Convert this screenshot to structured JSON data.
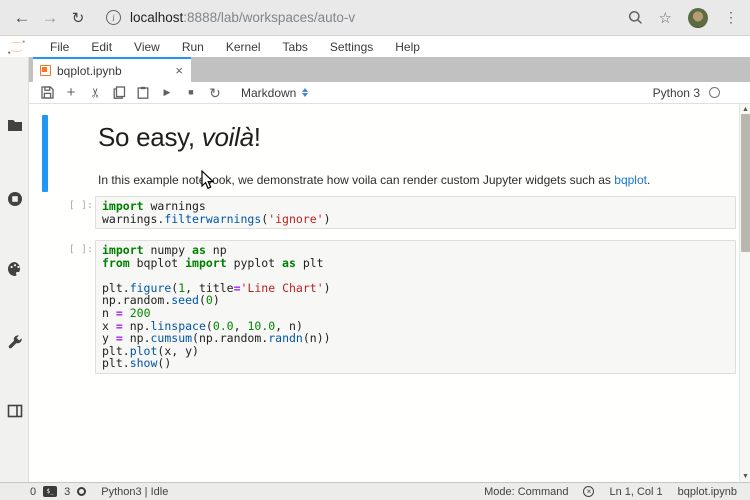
{
  "browser": {
    "back_icon": "left-arrow",
    "forward_icon": "right-arrow",
    "reload_icon": "reload-arrow",
    "url_host": "localhost",
    "url_path": ":8888/lab/workspaces/auto-v",
    "info_glyph": "i",
    "star_glyph": "☆",
    "menu_glyph": "⋮"
  },
  "menu_bar": {
    "items": [
      "File",
      "Edit",
      "View",
      "Run",
      "Kernel",
      "Tabs",
      "Settings",
      "Help"
    ]
  },
  "sidebar": {
    "icons": [
      "folder",
      "running-sessions",
      "palette",
      "wrench",
      "open-tabs"
    ]
  },
  "tab": {
    "title": "bqplot.ipynb",
    "close_glyph": "×"
  },
  "toolbar": {
    "add_glyph": "+",
    "cut_glyph": "✂",
    "run_glyph": "▶",
    "stop_glyph": "■",
    "restart_glyph": "↻",
    "cell_type": "Markdown",
    "kernel_name": "Python 3"
  },
  "notebook": {
    "heading_prefix": "So easy, ",
    "heading_italic": "voilà",
    "heading_suffix": "!",
    "paragraph_before_link": "In this example notebook, we demonstrate how voila can render custom Jupyter widgets such as ",
    "paragraph_link": "bqplot",
    "paragraph_after_link": ".",
    "code_cells": [
      {
        "prompt": "[ ]:",
        "lines": [
          [
            {
              "t": "kw",
              "v": "import"
            },
            {
              "t": "pl",
              "v": " warnings"
            }
          ],
          [
            {
              "t": "pl",
              "v": "warnings."
            },
            {
              "t": "prop",
              "v": "filterwarnings"
            },
            {
              "t": "pl",
              "v": "("
            },
            {
              "t": "str",
              "v": "'ignore'"
            },
            {
              "t": "pl",
              "v": ")"
            }
          ]
        ]
      },
      {
        "prompt": "[ ]:",
        "lines": [
          [
            {
              "t": "kw",
              "v": "import"
            },
            {
              "t": "pl",
              "v": " numpy "
            },
            {
              "t": "kw",
              "v": "as"
            },
            {
              "t": "pl",
              "v": " np"
            }
          ],
          [
            {
              "t": "kw",
              "v": "from"
            },
            {
              "t": "pl",
              "v": " bqplot "
            },
            {
              "t": "kw",
              "v": "import"
            },
            {
              "t": "pl",
              "v": " pyplot "
            },
            {
              "t": "kw",
              "v": "as"
            },
            {
              "t": "pl",
              "v": " plt"
            }
          ],
          [],
          [
            {
              "t": "pl",
              "v": "plt."
            },
            {
              "t": "prop",
              "v": "figure"
            },
            {
              "t": "pl",
              "v": "("
            },
            {
              "t": "num",
              "v": "1"
            },
            {
              "t": "pl",
              "v": ", title"
            },
            {
              "t": "op",
              "v": "="
            },
            {
              "t": "str",
              "v": "'Line Chart'"
            },
            {
              "t": "pl",
              "v": ")"
            }
          ],
          [
            {
              "t": "pl",
              "v": "np.random."
            },
            {
              "t": "prop",
              "v": "seed"
            },
            {
              "t": "pl",
              "v": "("
            },
            {
              "t": "num",
              "v": "0"
            },
            {
              "t": "pl",
              "v": ")"
            }
          ],
          [
            {
              "t": "pl",
              "v": "n "
            },
            {
              "t": "op",
              "v": "="
            },
            {
              "t": "pl",
              "v": " "
            },
            {
              "t": "num",
              "v": "200"
            }
          ],
          [
            {
              "t": "pl",
              "v": "x "
            },
            {
              "t": "op",
              "v": "="
            },
            {
              "t": "pl",
              "v": " np."
            },
            {
              "t": "prop",
              "v": "linspace"
            },
            {
              "t": "pl",
              "v": "("
            },
            {
              "t": "num",
              "v": "0.0"
            },
            {
              "t": "pl",
              "v": ", "
            },
            {
              "t": "num",
              "v": "10.0"
            },
            {
              "t": "pl",
              "v": ", n)"
            }
          ],
          [
            {
              "t": "pl",
              "v": "y "
            },
            {
              "t": "op",
              "v": "="
            },
            {
              "t": "pl",
              "v": " np."
            },
            {
              "t": "prop",
              "v": "cumsum"
            },
            {
              "t": "pl",
              "v": "(np.random."
            },
            {
              "t": "prop",
              "v": "randn"
            },
            {
              "t": "pl",
              "v": "(n))"
            }
          ],
          [
            {
              "t": "pl",
              "v": "plt."
            },
            {
              "t": "prop",
              "v": "plot"
            },
            {
              "t": "pl",
              "v": "(x, y)"
            }
          ],
          [
            {
              "t": "pl",
              "v": "plt."
            },
            {
              "t": "prop",
              "v": "show"
            },
            {
              "t": "pl",
              "v": "()"
            }
          ]
        ]
      }
    ]
  },
  "status_bar": {
    "terminals_count": "0",
    "terminal_icon_label": "$_",
    "kernels_count": "3",
    "kernel_status": "Python3 | Idle",
    "mode": "Mode: Command",
    "cursor_position": "Ln 1, Col 1",
    "file_name": "bqplot.ipynb"
  },
  "colors": {
    "accent_blue": "#2196f3",
    "jupyter_orange": "#f37726",
    "link_blue": "#1976d2",
    "syntax_keyword": "#008000",
    "syntax_property": "#0055aa",
    "syntax_string": "#ba2121",
    "syntax_number": "#008800",
    "syntax_operator": "#aa22ff"
  }
}
